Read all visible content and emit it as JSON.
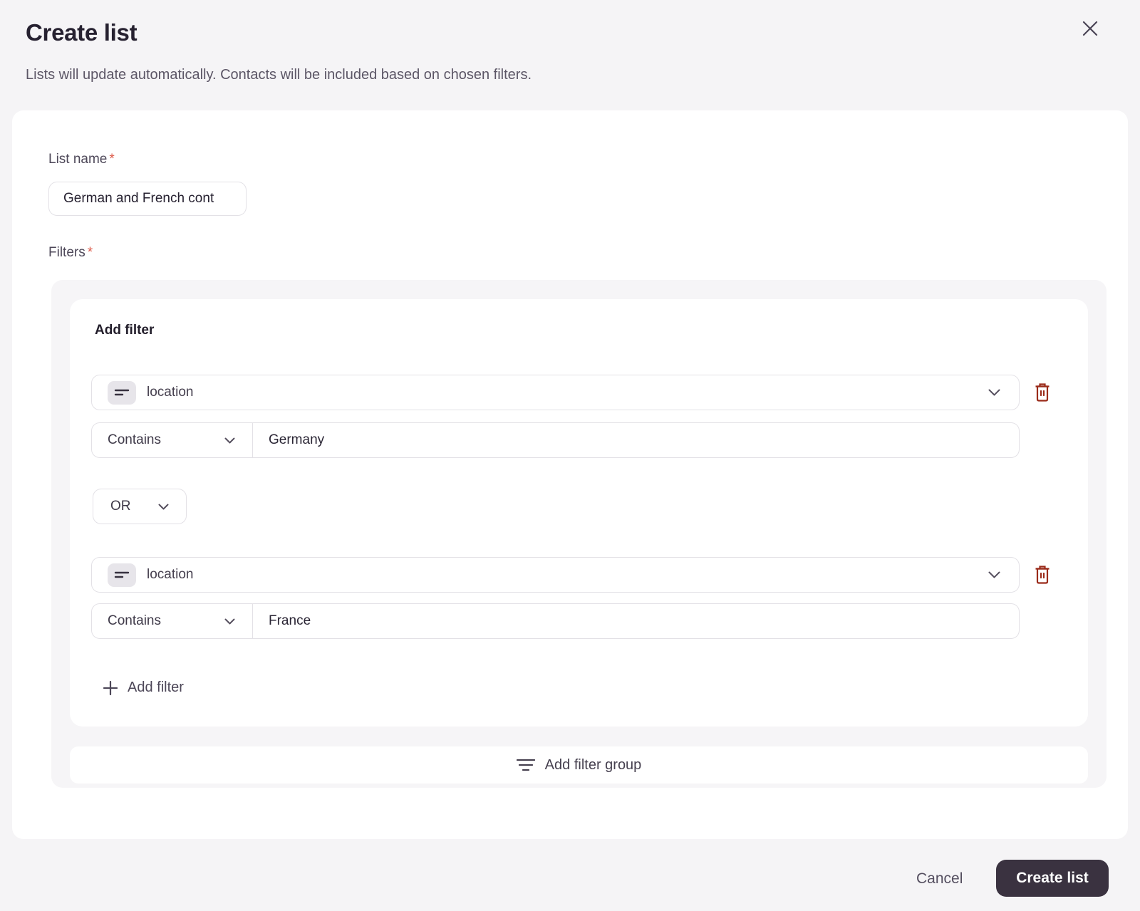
{
  "dialog": {
    "title": "Create list",
    "subtitle": "Lists will update automatically. Contacts will be included based on chosen filters."
  },
  "form": {
    "list_name": {
      "label": "List name",
      "required_marker": "*",
      "value": "German and French cont"
    },
    "filters": {
      "label": "Filters",
      "required_marker": "*",
      "group": {
        "heading": "Add filter",
        "logic_operator": "OR",
        "rows": [
          {
            "field": "location",
            "operator": "Contains",
            "value": "Germany"
          },
          {
            "field": "location",
            "operator": "Contains",
            "value": "France"
          }
        ],
        "add_filter_label": "Add filter",
        "add_filter_group_label": "Add filter group"
      }
    }
  },
  "footer": {
    "cancel_label": "Cancel",
    "submit_label": "Create list"
  },
  "icons": {
    "close": "x-icon",
    "field_type": "text-lines-icon",
    "delete": "trash-icon",
    "expand": "chevron-down-icon",
    "add": "plus-icon",
    "filter_group": "filter-lines-icon"
  },
  "colors": {
    "page_bg": "#f5f4f6",
    "card_bg": "#ffffff",
    "danger": "#9a2b1a",
    "primary_button_bg": "#3a3240",
    "required_asterisk": "#dd5a49",
    "border": "#e3e1e6"
  }
}
